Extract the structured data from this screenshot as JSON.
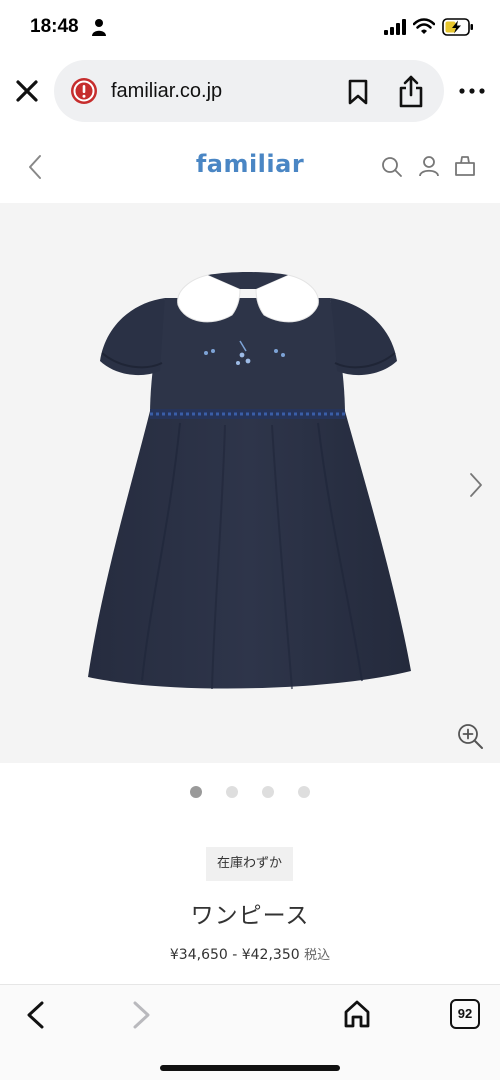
{
  "status_bar": {
    "time": "18:48",
    "icons": [
      "person-icon",
      "signal-icon",
      "wifi-icon",
      "battery-charging-icon"
    ]
  },
  "browser": {
    "url": "familiar.co.jp",
    "icons": [
      "close-icon",
      "warning-icon",
      "bookmark-icon",
      "share-icon",
      "more-icon"
    ]
  },
  "site_header": {
    "brand": "familiar",
    "icons": [
      "back-chevron-icon",
      "search-icon",
      "account-icon",
      "shopping-bag-icon"
    ],
    "brand_color": "#4a86c4"
  },
  "gallery": {
    "image": "navy-dress-with-white-collar",
    "total_images": 4,
    "active_image": 1,
    "icons": [
      "chevron-right-icon",
      "zoom-in-icon"
    ],
    "dress_color": "#2b3246",
    "background_color": "#f4f4f4"
  },
  "product": {
    "stock_badge": "在庫わずか",
    "name": "ワンピース",
    "price_range": "¥34,650 - ¥42,350",
    "tax_label": "税込"
  },
  "toolbar": {
    "tab_count": "92",
    "icons": [
      "back-icon",
      "forward-icon",
      "home-icon",
      "tabs-icon"
    ]
  }
}
